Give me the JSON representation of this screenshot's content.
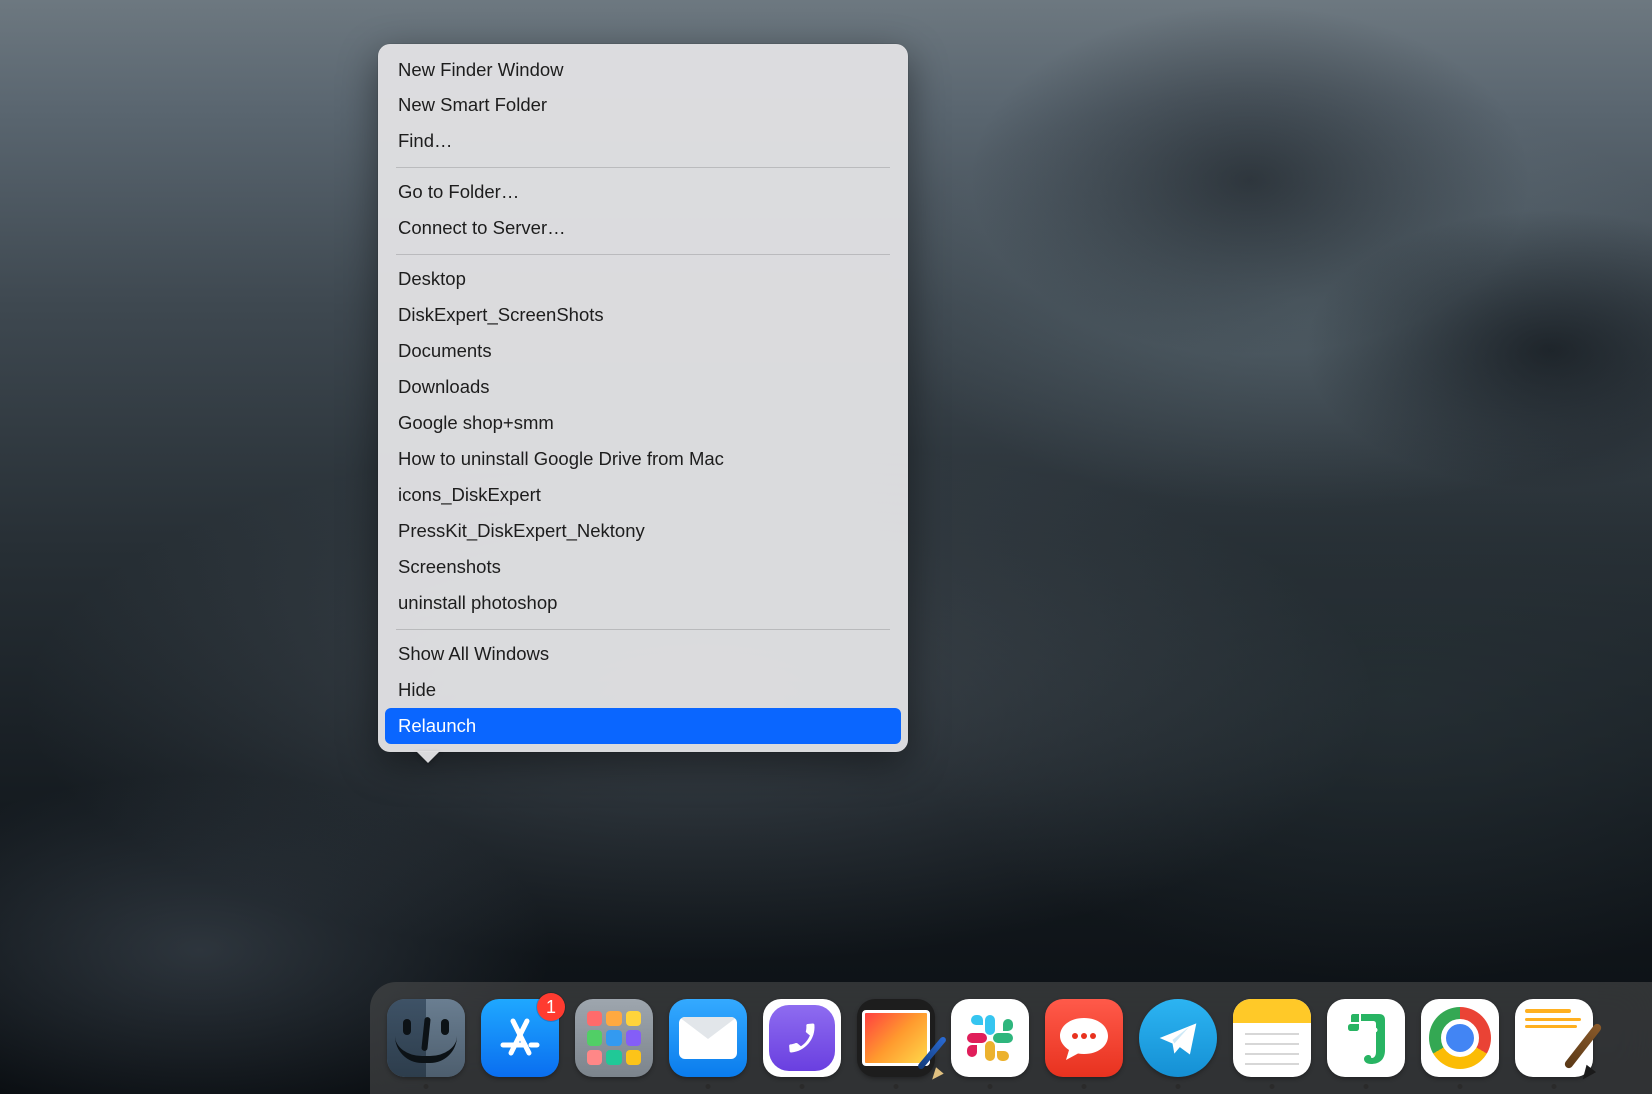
{
  "context_menu": {
    "sections": [
      {
        "items": [
          "New Finder Window",
          "New Smart Folder",
          "Find…"
        ]
      },
      {
        "items": [
          "Go to Folder…",
          "Connect to Server…"
        ]
      },
      {
        "items": [
          "Desktop",
          "DiskExpert_ScreenShots",
          "Documents",
          "Downloads",
          "Google shop+smm",
          "How to uninstall Google Drive from Mac",
          "icons_DiskExpert",
          "PressKit_DiskExpert_Nektony",
          "Screenshots",
          "uninstall photoshop"
        ]
      },
      {
        "items": [
          "Show All Windows",
          "Hide",
          "Relaunch"
        ]
      }
    ],
    "selected": "Relaunch"
  },
  "dock": {
    "apps": [
      {
        "name": "Finder",
        "icon": "finder-icon",
        "running": true,
        "badge": null
      },
      {
        "name": "App Store",
        "icon": "appstore-icon",
        "running": false,
        "badge": "1"
      },
      {
        "name": "Launchpad",
        "icon": "launchpad-icon",
        "running": false,
        "badge": null
      },
      {
        "name": "Mail",
        "icon": "mail-icon",
        "running": true,
        "badge": null
      },
      {
        "name": "Viber",
        "icon": "viber-icon",
        "running": true,
        "badge": null
      },
      {
        "name": "Pixelmator",
        "icon": "pixelmator-icon",
        "running": true,
        "badge": null
      },
      {
        "name": "Slack",
        "icon": "slack-icon",
        "running": true,
        "badge": null
      },
      {
        "name": "Chat",
        "icon": "chat-icon",
        "running": true,
        "badge": null
      },
      {
        "name": "Telegram",
        "icon": "telegram-icon",
        "running": true,
        "badge": null
      },
      {
        "name": "Notes",
        "icon": "notes-icon",
        "running": true,
        "badge": null
      },
      {
        "name": "Evernote",
        "icon": "evernote-icon",
        "running": true,
        "badge": null
      },
      {
        "name": "Chrome",
        "icon": "chrome-icon",
        "running": true,
        "badge": null
      },
      {
        "name": "Pages",
        "icon": "pages-icon",
        "running": true,
        "badge": null
      }
    ]
  },
  "colors": {
    "menu_bg": "#e0e0e2",
    "menu_highlight": "#0a66ff",
    "badge": "#ff3b30"
  }
}
